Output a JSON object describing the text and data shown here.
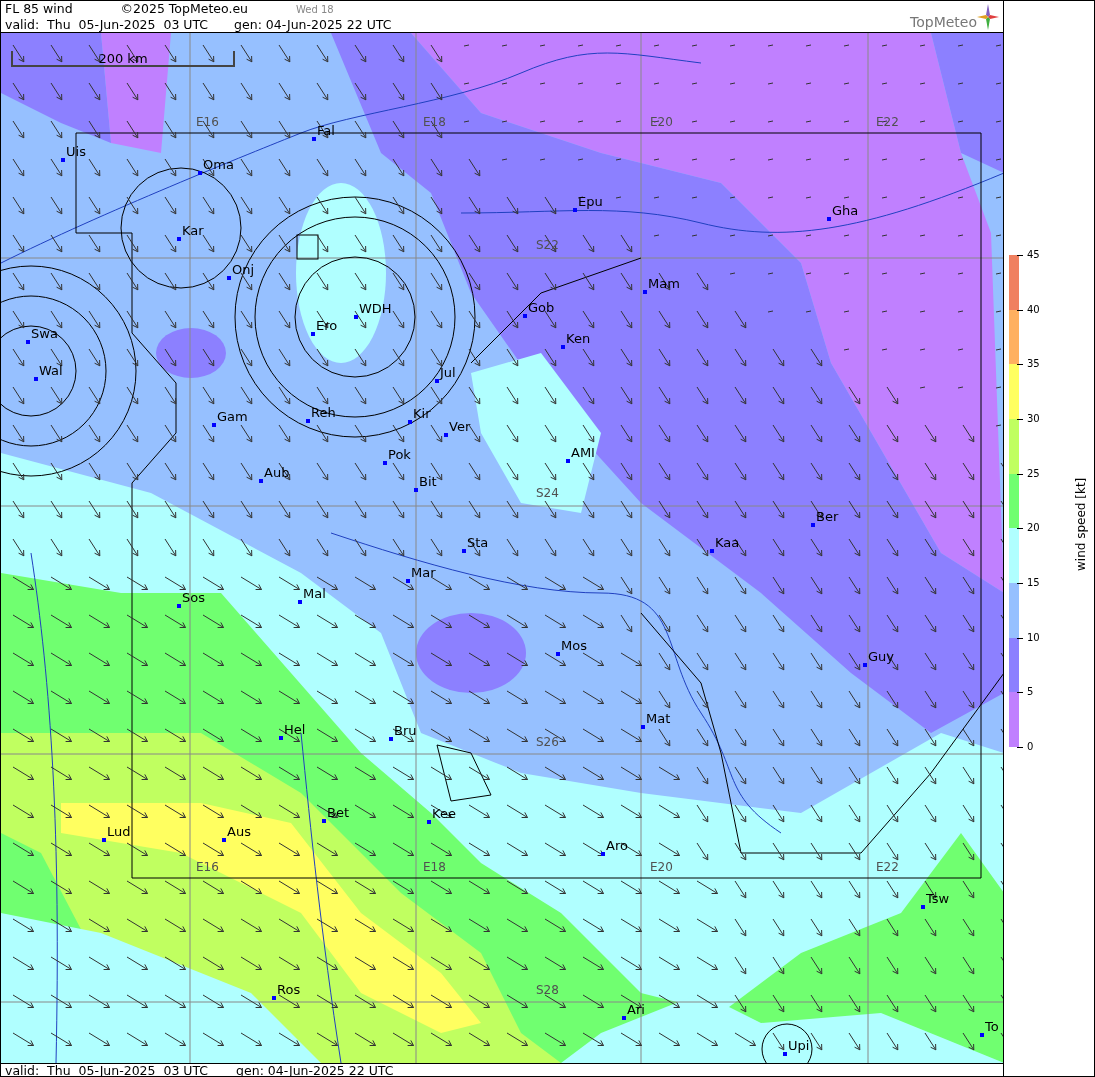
{
  "header": {
    "title": "FL 85 wind",
    "copyright": "©2025 TopMeteo.eu",
    "day": "Wed 18",
    "valid": "valid:  Thu  05-Jun-2025  03 UTC",
    "generated": "gen: 04-Jun-2025 22 UTC",
    "logo": "TopMeteo"
  },
  "map": {
    "scale_bar": "200 km",
    "grid_labels": [
      "E16",
      "E18",
      "E20",
      "E22",
      "S22",
      "S24",
      "S26",
      "S28",
      "E16",
      "E18",
      "E20",
      "E22"
    ],
    "places": [
      "Uis",
      "Oma",
      "Fal",
      "Epu",
      "Gha",
      "Kar",
      "Onj",
      "Mam",
      "Gob",
      "WDH",
      "Ero",
      "Swa",
      "Ken",
      "Wal",
      "Jul",
      "Gam",
      "Reh",
      "Kir",
      "Ver",
      "AMI",
      "Pok",
      "Bit",
      "Aub",
      "Ber",
      "Sta",
      "Kaa",
      "Mar",
      "Sos",
      "Mal",
      "Mos",
      "Guy",
      "Mat",
      "Hel",
      "Bru",
      "Bet",
      "Kee",
      "Lud",
      "Aus",
      "Aro",
      "Tsw",
      "Ros",
      "Ari",
      "Upi",
      "To"
    ]
  },
  "legend": {
    "title": "wind speed [kt]",
    "ticks": [
      "45",
      "40",
      "35",
      "30",
      "25",
      "20",
      "15",
      "10",
      "5",
      "0"
    ],
    "bands": [
      {
        "color": "#f08060"
      },
      {
        "color": "#ffb060"
      },
      {
        "color": "#ffff60"
      },
      {
        "color": "#c0ff60"
      },
      {
        "color": "#70ff70"
      },
      {
        "color": "#b0ffff"
      },
      {
        "color": "#96c0ff"
      },
      {
        "color": "#8c80ff"
      },
      {
        "color": "#c080ff"
      }
    ]
  },
  "footer": {
    "valid": "valid:  Thu  05-Jun-2025  03 UTC",
    "generated": "gen: 04-Jun-2025 22 UTC"
  }
}
